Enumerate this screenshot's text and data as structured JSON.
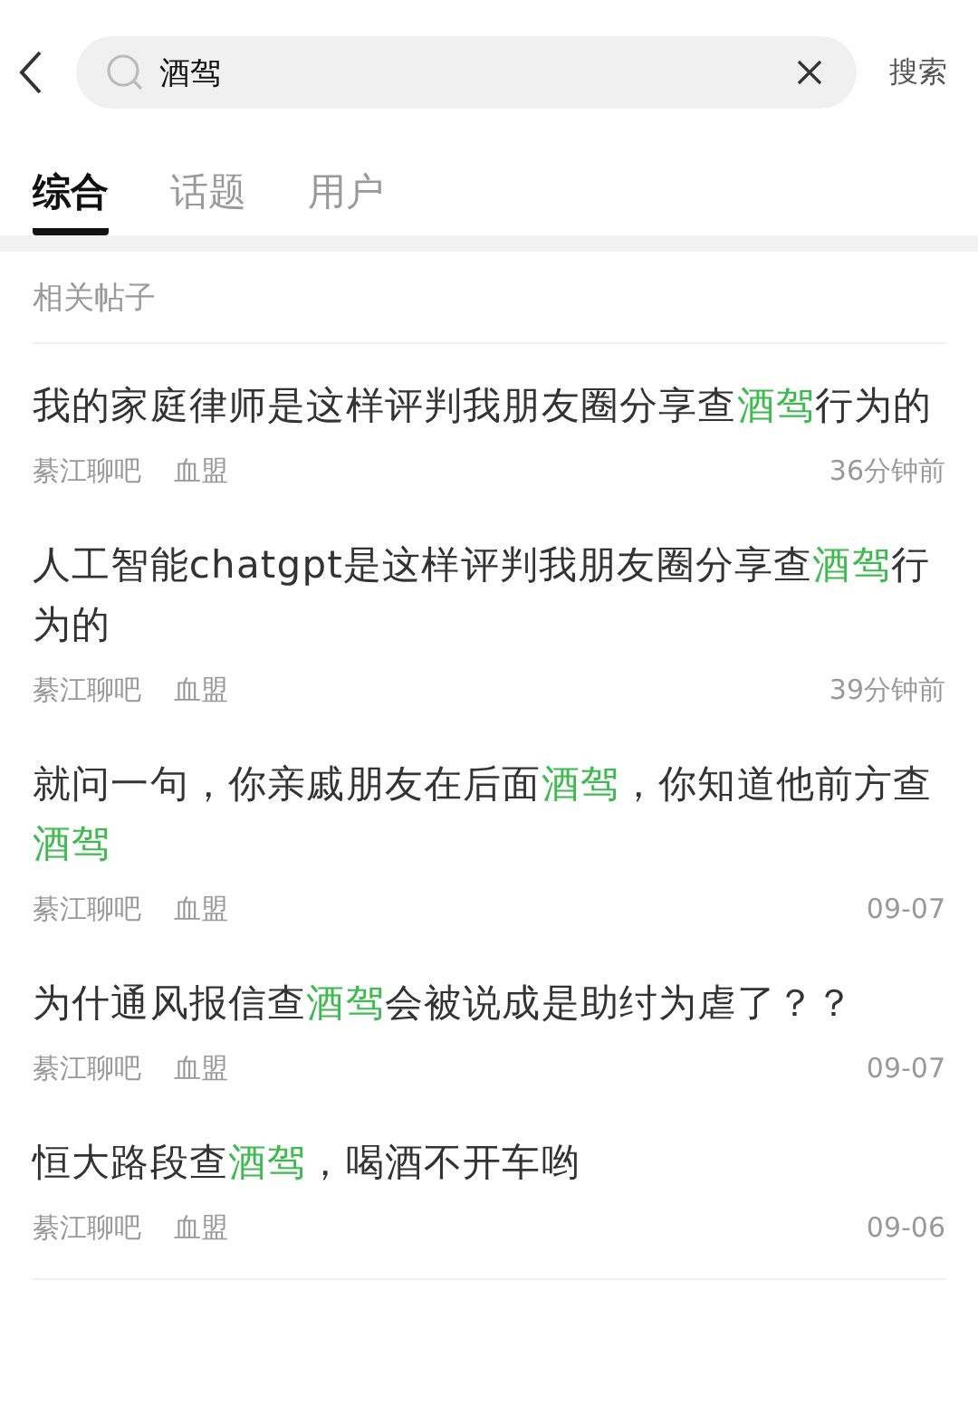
{
  "search": {
    "value": "酒驾",
    "button": "搜索"
  },
  "tabs": [
    {
      "label": "综合",
      "selected": true
    },
    {
      "label": "话题",
      "selected": false
    },
    {
      "label": "用户",
      "selected": false
    }
  ],
  "section_title": "相关帖子",
  "posts": [
    {
      "title": [
        {
          "text": "我的家庭律师是这样评判我朋友圈分享查",
          "highlight": false
        },
        {
          "text": "酒驾",
          "highlight": true
        },
        {
          "text": "行为的",
          "highlight": false
        }
      ],
      "forum": "綦江聊吧",
      "tag": "血盟",
      "time": "36分钟前"
    },
    {
      "title": [
        {
          "text": "人工智能chatgpt是这样评判我朋友圈分享查",
          "highlight": false
        },
        {
          "text": "酒驾",
          "highlight": true
        },
        {
          "text": "行为的",
          "highlight": false
        }
      ],
      "forum": "綦江聊吧",
      "tag": "血盟",
      "time": "39分钟前"
    },
    {
      "title": [
        {
          "text": "就问一句，你亲戚朋友在后面",
          "highlight": false
        },
        {
          "text": "酒驾",
          "highlight": true
        },
        {
          "text": "，你知道他前方查",
          "highlight": false
        },
        {
          "text": "酒驾",
          "highlight": true
        }
      ],
      "forum": "綦江聊吧",
      "tag": "血盟",
      "time": "09-07"
    },
    {
      "title": [
        {
          "text": "为什通风报信查",
          "highlight": false
        },
        {
          "text": "酒驾",
          "highlight": true
        },
        {
          "text": "会被说成是助纣为虐了？？",
          "highlight": false
        }
      ],
      "forum": "綦江聊吧",
      "tag": "血盟",
      "time": "09-07"
    },
    {
      "title": [
        {
          "text": "恒大路段查",
          "highlight": false
        },
        {
          "text": "酒驾",
          "highlight": true
        },
        {
          "text": "，喝酒不开车哟",
          "highlight": false
        }
      ],
      "forum": "綦江聊吧",
      "tag": "血盟",
      "time": "09-06"
    }
  ]
}
